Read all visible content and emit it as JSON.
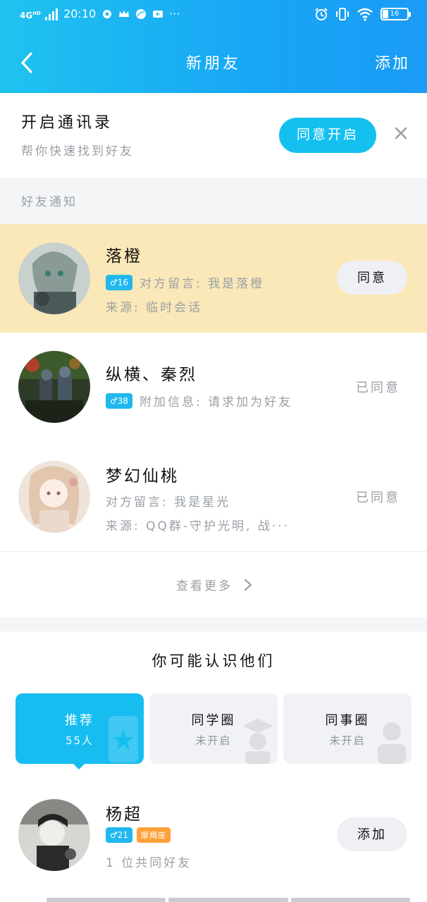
{
  "status_bar": {
    "network": "4G",
    "network_sup": "HD",
    "time": "20:10",
    "more": "···",
    "battery": "16"
  },
  "nav": {
    "title": "新朋友",
    "add_label": "添加"
  },
  "contacts_banner": {
    "title": "开启通讯录",
    "subtitle": "帮你快速找到好友",
    "enable_label": "同意开启"
  },
  "section_label": "好友通知",
  "requests": [
    {
      "name": "落橙",
      "age_badge": "♂16",
      "message": "对方留言:  我是落橙",
      "source": "来源:  临时会话",
      "action": "同意",
      "highlighted": true
    },
    {
      "name": "纵横、秦烈",
      "age_badge": "♂38",
      "message": "附加信息:  请求加为好友",
      "action_status": "已同意"
    },
    {
      "name": "梦幻仙桃",
      "message": "对方留言:  我是星光",
      "source": "来源:  QQ群-守护光明, 战···",
      "action_status": "已同意"
    }
  ],
  "see_more_label": "查看更多",
  "suggestions": {
    "heading": "你可能认识他们",
    "tabs": [
      {
        "label": "推荐",
        "sub": "55人",
        "active": true
      },
      {
        "label": "同学圈",
        "sub": "未开启"
      },
      {
        "label": "同事圈",
        "sub": "未开启"
      }
    ],
    "people": [
      {
        "name": "杨超",
        "age_badge": "♂21",
        "sign_badge": "摩羯座",
        "mutual": "1 位共同好友",
        "action": "添加"
      }
    ]
  },
  "colors": {
    "header_start": "#1ec3ef",
    "header_end": "#1b9bf5",
    "accent": "#13c0ef",
    "highlight_row": "#fbe8b8",
    "badge_blue": "#20b8ee",
    "badge_orange": "#ffa13a"
  }
}
